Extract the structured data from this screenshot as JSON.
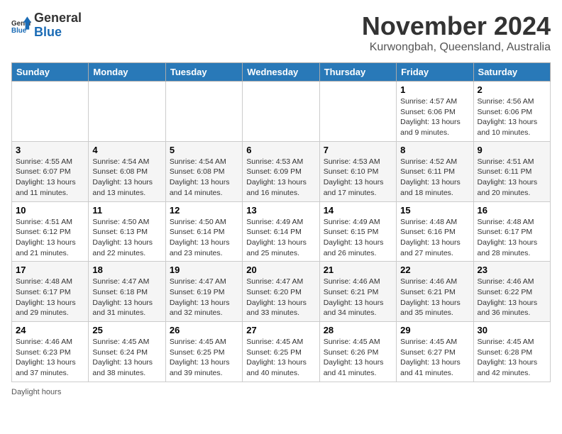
{
  "header": {
    "logo_general": "General",
    "logo_blue": "Blue",
    "month": "November 2024",
    "location": "Kurwongbah, Queensland, Australia"
  },
  "weekdays": [
    "Sunday",
    "Monday",
    "Tuesday",
    "Wednesday",
    "Thursday",
    "Friday",
    "Saturday"
  ],
  "weeks": [
    [
      {
        "day": "",
        "info": ""
      },
      {
        "day": "",
        "info": ""
      },
      {
        "day": "",
        "info": ""
      },
      {
        "day": "",
        "info": ""
      },
      {
        "day": "",
        "info": ""
      },
      {
        "day": "1",
        "info": "Sunrise: 4:57 AM\nSunset: 6:06 PM\nDaylight: 13 hours and 9 minutes."
      },
      {
        "day": "2",
        "info": "Sunrise: 4:56 AM\nSunset: 6:06 PM\nDaylight: 13 hours and 10 minutes."
      }
    ],
    [
      {
        "day": "3",
        "info": "Sunrise: 4:55 AM\nSunset: 6:07 PM\nDaylight: 13 hours and 11 minutes."
      },
      {
        "day": "4",
        "info": "Sunrise: 4:54 AM\nSunset: 6:08 PM\nDaylight: 13 hours and 13 minutes."
      },
      {
        "day": "5",
        "info": "Sunrise: 4:54 AM\nSunset: 6:08 PM\nDaylight: 13 hours and 14 minutes."
      },
      {
        "day": "6",
        "info": "Sunrise: 4:53 AM\nSunset: 6:09 PM\nDaylight: 13 hours and 16 minutes."
      },
      {
        "day": "7",
        "info": "Sunrise: 4:53 AM\nSunset: 6:10 PM\nDaylight: 13 hours and 17 minutes."
      },
      {
        "day": "8",
        "info": "Sunrise: 4:52 AM\nSunset: 6:11 PM\nDaylight: 13 hours and 18 minutes."
      },
      {
        "day": "9",
        "info": "Sunrise: 4:51 AM\nSunset: 6:11 PM\nDaylight: 13 hours and 20 minutes."
      }
    ],
    [
      {
        "day": "10",
        "info": "Sunrise: 4:51 AM\nSunset: 6:12 PM\nDaylight: 13 hours and 21 minutes."
      },
      {
        "day": "11",
        "info": "Sunrise: 4:50 AM\nSunset: 6:13 PM\nDaylight: 13 hours and 22 minutes."
      },
      {
        "day": "12",
        "info": "Sunrise: 4:50 AM\nSunset: 6:14 PM\nDaylight: 13 hours and 23 minutes."
      },
      {
        "day": "13",
        "info": "Sunrise: 4:49 AM\nSunset: 6:14 PM\nDaylight: 13 hours and 25 minutes."
      },
      {
        "day": "14",
        "info": "Sunrise: 4:49 AM\nSunset: 6:15 PM\nDaylight: 13 hours and 26 minutes."
      },
      {
        "day": "15",
        "info": "Sunrise: 4:48 AM\nSunset: 6:16 PM\nDaylight: 13 hours and 27 minutes."
      },
      {
        "day": "16",
        "info": "Sunrise: 4:48 AM\nSunset: 6:17 PM\nDaylight: 13 hours and 28 minutes."
      }
    ],
    [
      {
        "day": "17",
        "info": "Sunrise: 4:48 AM\nSunset: 6:17 PM\nDaylight: 13 hours and 29 minutes."
      },
      {
        "day": "18",
        "info": "Sunrise: 4:47 AM\nSunset: 6:18 PM\nDaylight: 13 hours and 31 minutes."
      },
      {
        "day": "19",
        "info": "Sunrise: 4:47 AM\nSunset: 6:19 PM\nDaylight: 13 hours and 32 minutes."
      },
      {
        "day": "20",
        "info": "Sunrise: 4:47 AM\nSunset: 6:20 PM\nDaylight: 13 hours and 33 minutes."
      },
      {
        "day": "21",
        "info": "Sunrise: 4:46 AM\nSunset: 6:21 PM\nDaylight: 13 hours and 34 minutes."
      },
      {
        "day": "22",
        "info": "Sunrise: 4:46 AM\nSunset: 6:21 PM\nDaylight: 13 hours and 35 minutes."
      },
      {
        "day": "23",
        "info": "Sunrise: 4:46 AM\nSunset: 6:22 PM\nDaylight: 13 hours and 36 minutes."
      }
    ],
    [
      {
        "day": "24",
        "info": "Sunrise: 4:46 AM\nSunset: 6:23 PM\nDaylight: 13 hours and 37 minutes."
      },
      {
        "day": "25",
        "info": "Sunrise: 4:45 AM\nSunset: 6:24 PM\nDaylight: 13 hours and 38 minutes."
      },
      {
        "day": "26",
        "info": "Sunrise: 4:45 AM\nSunset: 6:25 PM\nDaylight: 13 hours and 39 minutes."
      },
      {
        "day": "27",
        "info": "Sunrise: 4:45 AM\nSunset: 6:25 PM\nDaylight: 13 hours and 40 minutes."
      },
      {
        "day": "28",
        "info": "Sunrise: 4:45 AM\nSunset: 6:26 PM\nDaylight: 13 hours and 41 minutes."
      },
      {
        "day": "29",
        "info": "Sunrise: 4:45 AM\nSunset: 6:27 PM\nDaylight: 13 hours and 41 minutes."
      },
      {
        "day": "30",
        "info": "Sunrise: 4:45 AM\nSunset: 6:28 PM\nDaylight: 13 hours and 42 minutes."
      }
    ]
  ],
  "footer": {
    "daylight_label": "Daylight hours"
  }
}
